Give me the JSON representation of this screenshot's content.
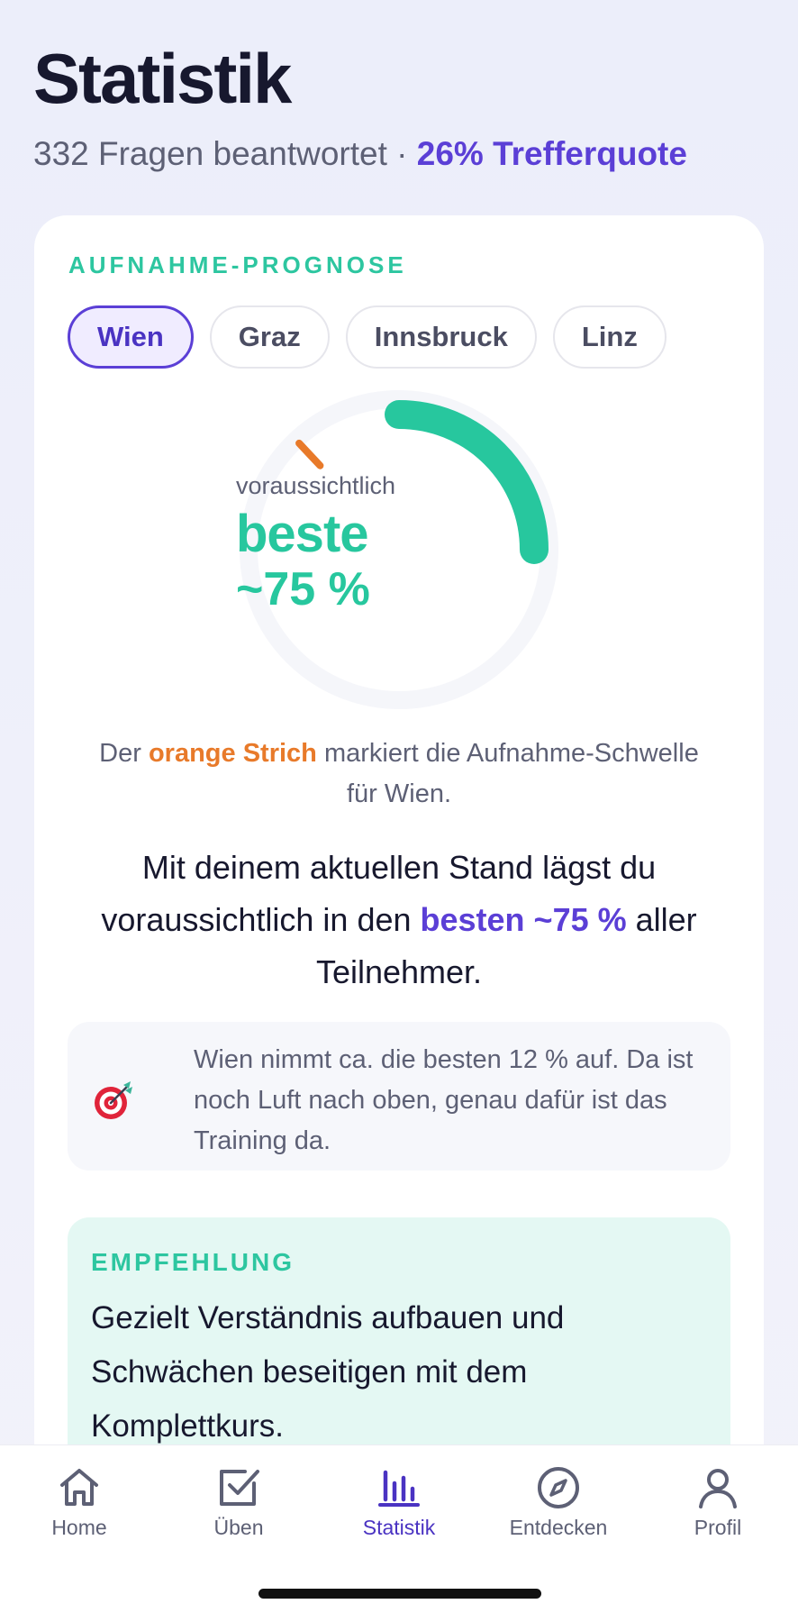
{
  "header": {
    "title": "Statistik",
    "subtitle_prefix": "332 Fragen beantwortet · ",
    "subtitle_accent": "26% Trefferquote"
  },
  "card": {
    "section_label": "AUFNAHME-PROGNOSE",
    "chips": [
      {
        "label": "Wien",
        "active": true
      },
      {
        "label": "Graz",
        "active": false
      },
      {
        "label": "Innsbruck",
        "active": false
      },
      {
        "label": "Linz",
        "active": false
      }
    ],
    "gauge": {
      "caption": "voraussichtlich",
      "value_line1": "beste",
      "value_line2": "~75 %",
      "progress_fraction": 0.25,
      "threshold_fraction": 0.88,
      "progress_color": "#27c79e",
      "threshold_color": "#e87a2a"
    },
    "note": {
      "prefix": "Der ",
      "highlight": "orange Strich",
      "suffix": " markiert die Aufnahme-Schwelle für Wien."
    },
    "main_text": {
      "prefix": "Mit deinem aktuellen Stand lägst du voraussichtlich in den ",
      "highlight": "besten ~75 %",
      "suffix": " aller Teilnehmer."
    },
    "info": {
      "icon": "target-dart-icon",
      "text": "Wien nimmt ca. die besten 12 % auf. Da ist noch Luft nach oben, genau dafür ist das Training da."
    },
    "recommendation": {
      "label": "EMPFEHLUNG",
      "text": "Gezielt Verständnis aufbauen und Schwächen beseitigen mit dem Komplettkurs."
    }
  },
  "tabbar": {
    "tabs": [
      {
        "label": "Home",
        "icon": "home-icon",
        "active": false
      },
      {
        "label": "Üben",
        "icon": "checkbox-icon",
        "active": false
      },
      {
        "label": "Statistik",
        "icon": "bar-chart-icon",
        "active": true
      },
      {
        "label": "Entdecken",
        "icon": "compass-icon",
        "active": false
      },
      {
        "label": "Profil",
        "icon": "user-icon",
        "active": false
      }
    ]
  },
  "colors": {
    "accent": "#5b3fd6",
    "teal": "#27c79e",
    "orange": "#e87a2a"
  }
}
